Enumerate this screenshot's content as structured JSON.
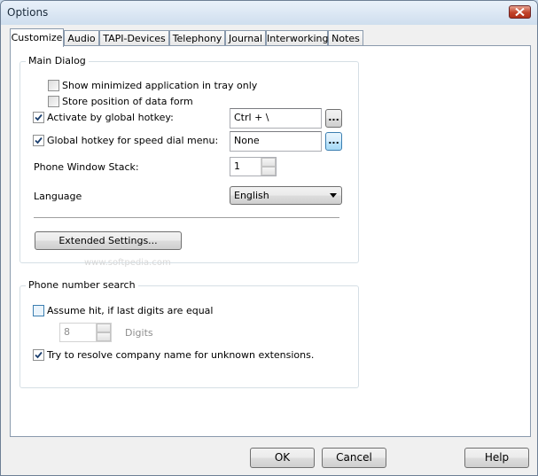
{
  "window": {
    "title": "Options"
  },
  "tabs": [
    {
      "label": "Customize",
      "active": true
    },
    {
      "label": "Audio",
      "active": false
    },
    {
      "label": "TAPI-Devices",
      "active": false
    },
    {
      "label": "Telephony",
      "active": false
    },
    {
      "label": "Journal",
      "active": false
    },
    {
      "label": "Interworking",
      "active": false
    },
    {
      "label": "Notes",
      "active": false
    }
  ],
  "main_dialog": {
    "title": "Main Dialog",
    "show_minimized": {
      "label": "Show minimized application in tray only",
      "checked": false
    },
    "store_position": {
      "label": "Store position of data form",
      "checked": false
    },
    "activate_hotkey": {
      "label": "Activate by global hotkey:",
      "checked": true,
      "value": "Ctrl + \\",
      "browse_label": "..."
    },
    "speed_dial_hotkey": {
      "label": "Global hotkey for speed dial menu:",
      "checked": true,
      "value": "None",
      "browse_label": "..."
    },
    "phone_window_stack": {
      "label": "Phone Window Stack:",
      "value": "1"
    },
    "language": {
      "label": "Language",
      "value": "English"
    },
    "extended_settings_label": "Extended Settings..."
  },
  "phone_search": {
    "title": "Phone number search",
    "assume_hit": {
      "label": "Assume hit, if last digits are equal",
      "checked": false
    },
    "digits": {
      "value": "8",
      "label": "Digits"
    },
    "resolve_company": {
      "label": "Try to resolve company name for unknown extensions.",
      "checked": true
    }
  },
  "buttons": {
    "ok": "OK",
    "cancel": "Cancel",
    "help": "Help"
  },
  "watermark": "www.softpedia.com",
  "colors": {
    "titlebar": "#cfdeee",
    "close_button": "#c2432a",
    "focus_border": "#3c7fb1"
  }
}
